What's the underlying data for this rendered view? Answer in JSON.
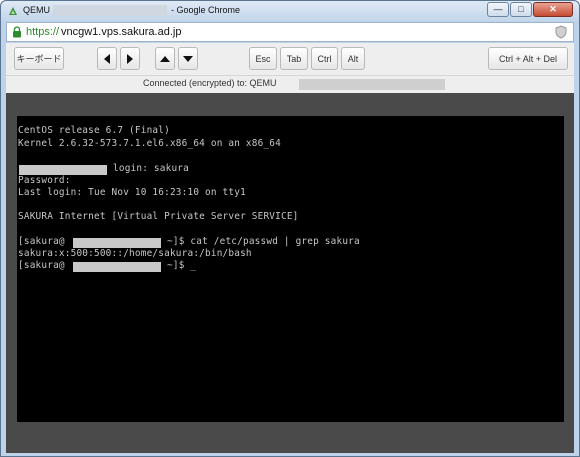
{
  "window": {
    "app_name": "QEMU",
    "title_suffix": "- Google Chrome"
  },
  "address": {
    "scheme": "https://",
    "host": "vncgw1.vps.sakura.ad.jp"
  },
  "toolbar": {
    "keyboard_label": "キーボード",
    "esc_label": "Esc",
    "tab_label": "Tab",
    "ctrl_label": "Ctrl",
    "alt_label": "Alt",
    "cad_label": "Ctrl + Alt + Del"
  },
  "status": {
    "text": "Connected (encrypted) to: QEMU"
  },
  "terminal": {
    "line_release": "CentOS release 6.7 (Final)",
    "line_kernel": "Kernel 2.6.32-573.7.1.el6.x86_64 on an x86_64",
    "login_text": "login: sakura",
    "line_password": "Password:",
    "line_lastlogin": "Last login: Tue Nov 10 16:23:10 on tty1",
    "line_banner": "SAKURA Internet [Virtual Private Server SERVICE]",
    "prompt_user": "[sakura@",
    "cmd_text": "~]$ cat /etc/passwd | grep sakura",
    "line_passwd_output": "sakura:x:500:500::/home/sakura:/bin/bash",
    "prompt_end": "~]$ _"
  },
  "colors": {
    "titlebar": "#c3d6ea",
    "url_scheme": "#2e8b2e",
    "terminal_bg": "#000000",
    "terminal_fg": "#c6c6c6",
    "viewer_bg": "#4a4a4a"
  }
}
